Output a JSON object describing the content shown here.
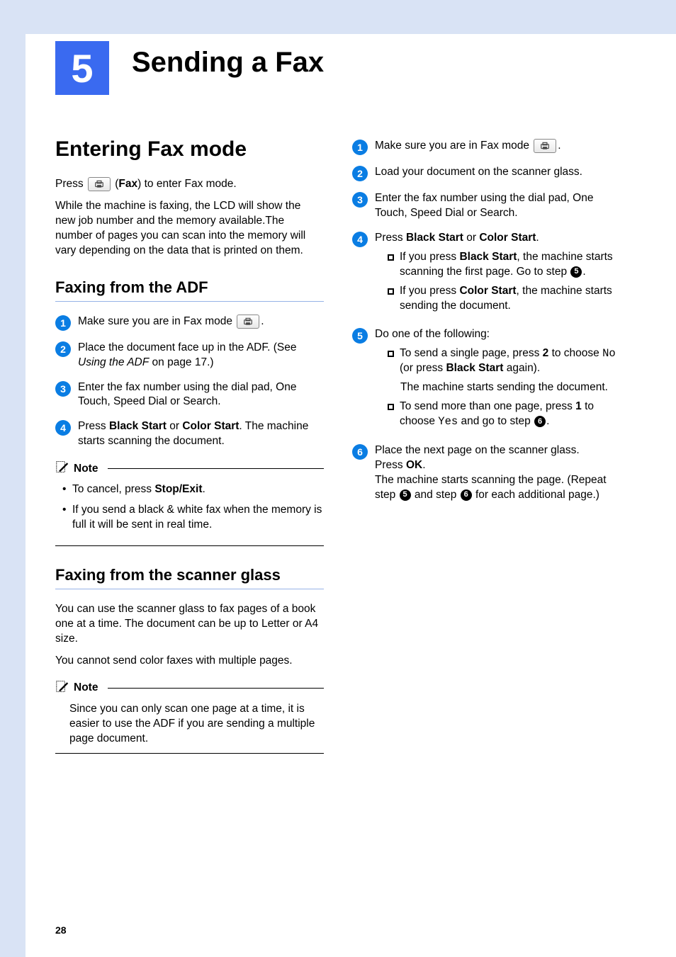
{
  "chapter": {
    "number": "5",
    "title": "Sending a Fax"
  },
  "left": {
    "h1": "Entering Fax mode",
    "p1a": "Press ",
    "p1b": " (",
    "p1c": "Fax",
    "p1d": ") to enter Fax mode.",
    "p2": "While the machine is faxing, the LCD will show the new job number and the memory available.The number of pages you can scan into the memory will vary depending on the data that is printed on them.",
    "h2a": "Faxing from the ADF",
    "adf": {
      "s1a": "Make sure you are in Fax mode ",
      "s1b": ".",
      "s2a": "Place the document face up in the ADF. (See ",
      "s2b": "Using the ADF",
      "s2c": " on page 17.)",
      "s3": "Enter the fax number using the dial pad, One Touch, Speed Dial or Search.",
      "s4a": "Press ",
      "s4b": "Black Start",
      "s4c": " or ",
      "s4d": "Color Start",
      "s4e": ". The machine starts scanning the document."
    },
    "note1": {
      "label": "Note",
      "li1a": "To cancel, press ",
      "li1b": "Stop/Exit",
      "li1c": ".",
      "li2": "If you send a black & white fax when the memory is full it will be sent in real time."
    },
    "h2b": "Faxing from the scanner glass",
    "pg1": "You can use the scanner glass to fax pages of a book one at a time. The document can be up to Letter or A4 size.",
    "pg2": "You cannot send color faxes with multiple pages.",
    "note2": {
      "label": "Note",
      "text": "Since you can only scan one page at a time, it is easier to use the ADF if you are sending a multiple page document."
    }
  },
  "right": {
    "s1a": "Make sure you are in Fax mode ",
    "s1b": ".",
    "s2": "Load your document on the scanner glass.",
    "s3": "Enter the fax number using the dial pad, One Touch, Speed Dial or Search.",
    "s4a": "Press ",
    "s4b": "Black Start",
    "s4c": " or ",
    "s4d": "Color Start",
    "s4e": ".",
    "s4_b1a": "If you press ",
    "s4_b1b": "Black Start",
    "s4_b1c": ", the machine starts scanning the first page. Go to step ",
    "s4_b1d": ".",
    "s4_b2a": "If you press ",
    "s4_b2b": "Color Start",
    "s4_b2c": ", the machine starts sending the document.",
    "s5": "Do one of the following:",
    "s5_b1a": "To send a single page, press ",
    "s5_b1b": "2",
    "s5_b1c": " to choose ",
    "s5_b1d": "No",
    "s5_b1e": " (or press ",
    "s5_b1f": "Black Start",
    "s5_b1g": " again).",
    "s5_b1_sub": "The machine starts sending the document.",
    "s5_b2a": "To send more than one page, press ",
    "s5_b2b": "1",
    "s5_b2c": " to choose ",
    "s5_b2d": "Yes",
    "s5_b2e": " and go to step ",
    "s5_b2f": ".",
    "s6a": "Place the next page on the scanner glass.",
    "s6b": "Press ",
    "s6c": "OK",
    "s6d": ".",
    "s6e": "The machine starts scanning the page. (Repeat step ",
    "s6f": " and step ",
    "s6g": " for each additional page.)",
    "ref5": "5",
    "ref6": "6"
  },
  "pageNumber": "28"
}
